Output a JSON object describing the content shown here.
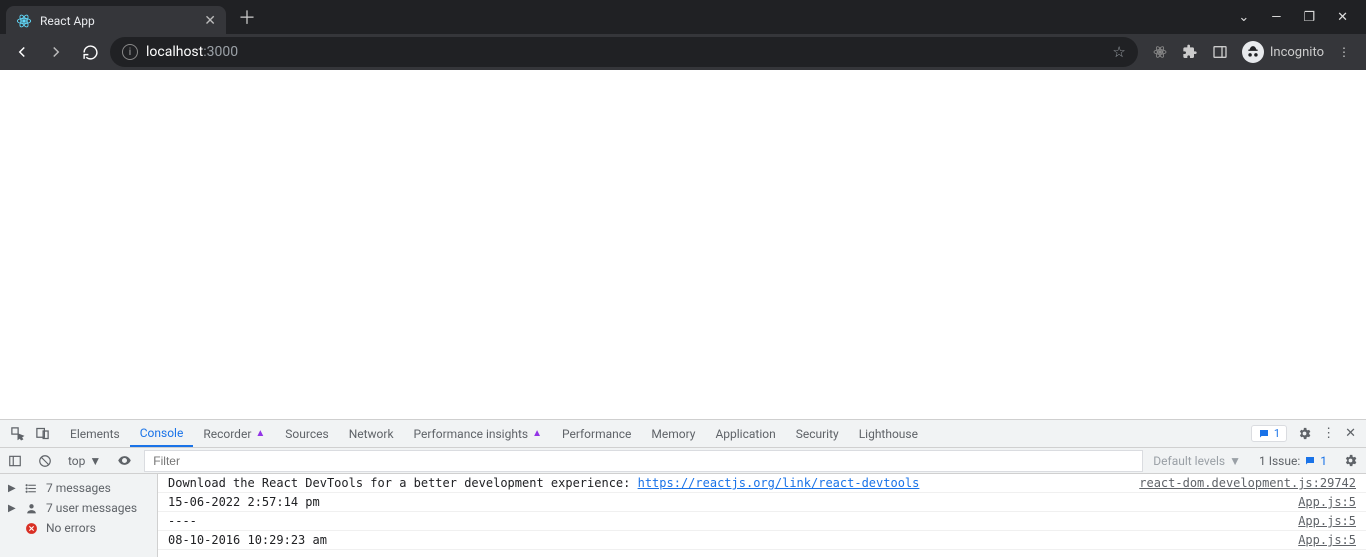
{
  "browser": {
    "tab_title": "React App",
    "url_host": "localhost",
    "url_port": ":3000",
    "incognito_label": "Incognito"
  },
  "devtools": {
    "tabs": [
      "Elements",
      "Console",
      "Recorder",
      "Sources",
      "Network",
      "Performance insights",
      "Performance",
      "Memory",
      "Application",
      "Security",
      "Lighthouse"
    ],
    "active_tab": "Console",
    "experimental_tabs": [
      "Recorder",
      "Performance insights"
    ],
    "message_chip": "1",
    "filter_placeholder": "Filter",
    "context_label": "top",
    "levels_label": "Default levels",
    "issues_label": "1 Issue:",
    "issues_count": "1",
    "sidebar": [
      {
        "icon": "list",
        "label": "7 messages",
        "caret": true
      },
      {
        "icon": "user",
        "label": "7 user messages",
        "caret": true
      },
      {
        "icon": "error",
        "label": "No errors",
        "caret": false
      }
    ],
    "logs": [
      {
        "text": "Download the React DevTools for a better development experience: ",
        "link": "https://reactjs.org/link/react-devtools",
        "source": "react-dom.development.js:29742"
      },
      {
        "text": "15-06-2022 2:57:14 pm",
        "source": "App.js:5"
      },
      {
        "text": "----",
        "source": "App.js:5"
      },
      {
        "text": "08-10-2016 10:29:23 am",
        "source": "App.js:5"
      }
    ]
  }
}
